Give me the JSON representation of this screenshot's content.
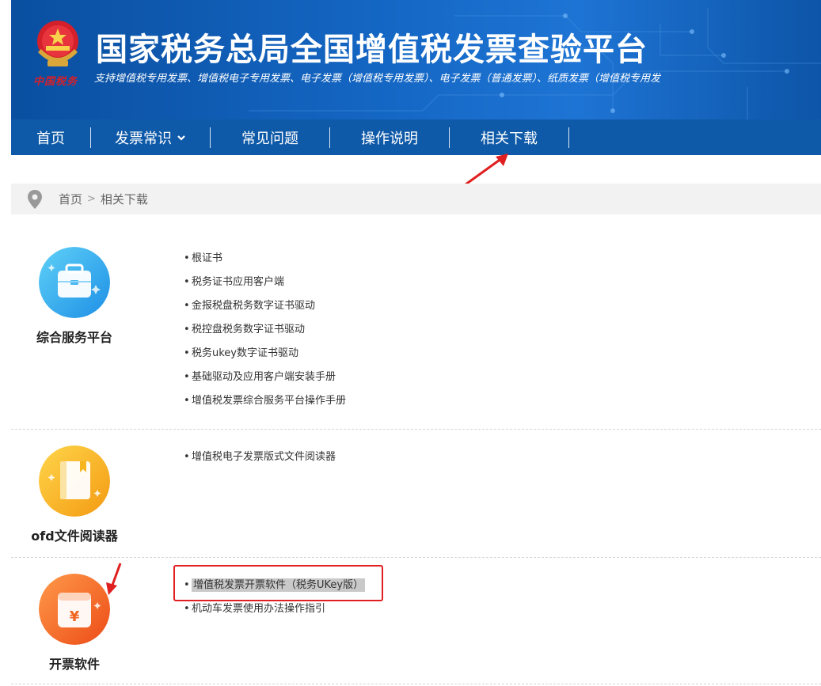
{
  "header": {
    "title": "国家税务总局全国增值税发票查验平台",
    "subtitle": "支持增值税专用发票、增值税电子专用发票、电子发票（增值税专用发票）、电子发票（普通发票）、纸质发票（增值税专用发",
    "emblem_text": "中国税务"
  },
  "nav": {
    "items": [
      {
        "label": "首页"
      },
      {
        "label": "发票常识"
      },
      {
        "label": "常见问题"
      },
      {
        "label": "操作说明"
      },
      {
        "label": "相关下载"
      }
    ]
  },
  "breadcrumb": {
    "home": "首页",
    "separator": ">",
    "current": "相关下载"
  },
  "sections": [
    {
      "title": "综合服务平台",
      "icon": "briefcase-icon",
      "links": [
        "根证书",
        "税务证书应用客户端",
        "金报税盘税务数字证书驱动",
        "税控盘税务数字证书驱动",
        "税务ukey数字证书驱动",
        "基础驱动及应用客户端安装手册",
        "增值税发票综合服务平台操作手册"
      ]
    },
    {
      "title": "ofd文件阅读器",
      "icon": "book-icon",
      "links": [
        "增值税电子发票版式文件阅读器"
      ]
    },
    {
      "title": "开票软件",
      "icon": "invoice-yuan-icon",
      "links": [
        "增值税发票开票软件（税务UKey版）",
        "机动车发票使用办法操作指引"
      ]
    }
  ],
  "colors": {
    "nav_bg": "#0f5aa8",
    "banner": "#1466c3",
    "annotation_red": "#e02020",
    "icon_blue": "#2aa8ee",
    "icon_yellow": "#f7b520",
    "icon_orange": "#f26422"
  }
}
